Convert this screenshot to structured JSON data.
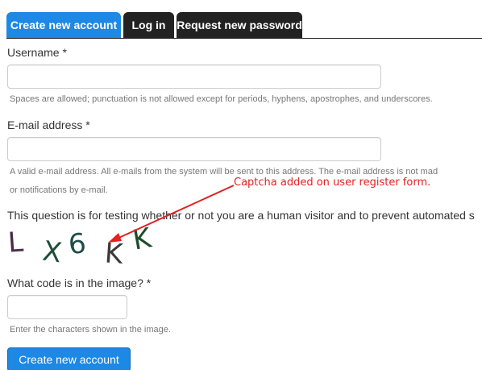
{
  "tabs": [
    {
      "label": "Create new account",
      "active": true
    },
    {
      "label": "Log in",
      "active": false
    },
    {
      "label": "Request new password",
      "active": false
    }
  ],
  "form": {
    "username": {
      "label": "Username",
      "required_marker": "*",
      "value": "",
      "description": "Spaces are allowed; punctuation is not allowed except for periods, hyphens, apostrophes, and underscores."
    },
    "email": {
      "label": "E-mail address",
      "required_marker": "*",
      "value": "",
      "description_line1": "A valid e-mail address. All e-mails from the system will be sent to this address. The e-mail address is not mad",
      "description_line2": "or notifications by e-mail."
    },
    "captcha": {
      "question": "This question is for testing whether or not you are a human visitor and to prevent automated s",
      "image_chars": [
        "L",
        "X",
        "6",
        "K",
        "K"
      ],
      "image_colors": [
        "#4a2a4a",
        "#1f4d3a",
        "#1f4d4a",
        "#3a3a3a",
        "#1f4d2a"
      ],
      "code_label": "What code is in the image?",
      "required_marker": "*",
      "value": "",
      "description": "Enter the characters shown in the image."
    },
    "submit_label": "Create new account"
  },
  "annotation": {
    "text": "Captcha added on user register form.",
    "color": "#e32222"
  },
  "colors": {
    "accent": "#1e88e5",
    "tab_inactive": "#222222"
  }
}
